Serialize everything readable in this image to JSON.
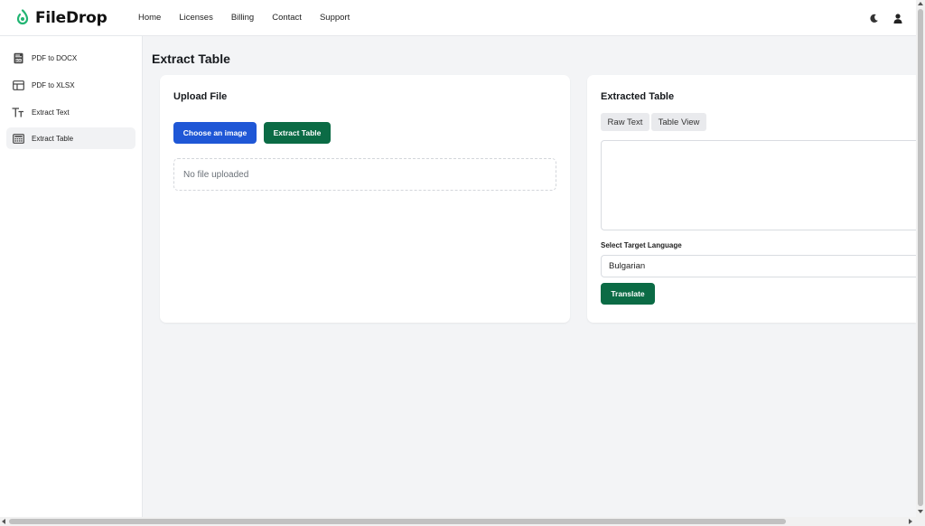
{
  "app": {
    "name": "FileDrop",
    "brand_color": "#22b573"
  },
  "nav": {
    "items": [
      "Home",
      "Licenses",
      "Billing",
      "Contact",
      "Support"
    ]
  },
  "header_icons": [
    "moon-icon",
    "user-icon"
  ],
  "sidebar": {
    "items": [
      {
        "label": "PDF to DOCX",
        "icon": "doc-file-icon",
        "active": false
      },
      {
        "label": "PDF to XLSX",
        "icon": "table-layout-icon",
        "active": false
      },
      {
        "label": "Extract Text",
        "icon": "text-format-icon",
        "active": false
      },
      {
        "label": "Extract Table",
        "icon": "calculator-table-icon",
        "active": true
      }
    ]
  },
  "page": {
    "title": "Extract Table"
  },
  "upload": {
    "title": "Upload File",
    "choose_label": "Choose an image",
    "extract_label": "Extract Table",
    "dropzone_text": "No file uploaded"
  },
  "extracted": {
    "title": "Extracted Table",
    "tabs": [
      "Raw Text",
      "Table View"
    ],
    "textarea_value": "",
    "language_label": "Select Target Language",
    "language_value": "Bulgarian",
    "translate_label": "Translate"
  },
  "colors": {
    "primary": "#1f57d6",
    "success": "#0b6b45"
  }
}
